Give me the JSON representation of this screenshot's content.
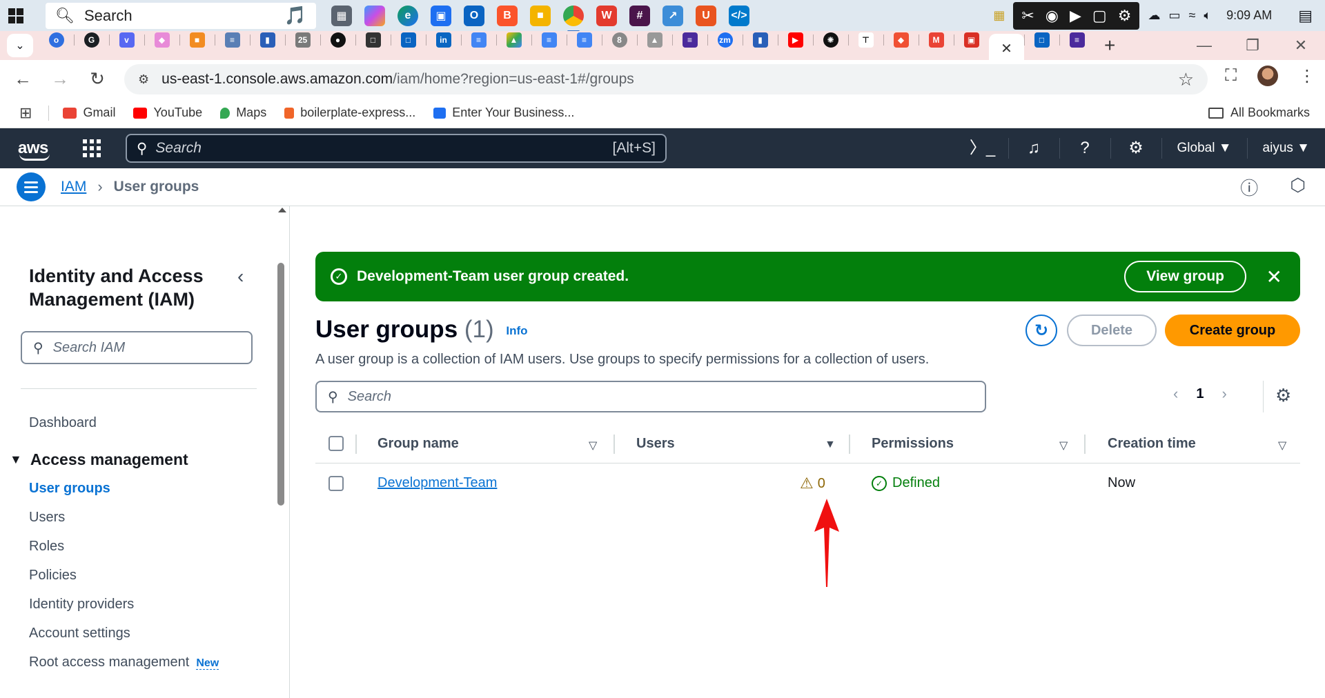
{
  "taskbar": {
    "search_placeholder": "Search",
    "time": "9:09 AM"
  },
  "browser": {
    "url_host": "us-east-1.console.aws.amazon.com",
    "url_path": "/iam/home?region=us-east-1#/groups",
    "bookmarks": [
      {
        "label": "Gmail",
        "color": "#ea4335"
      },
      {
        "label": "YouTube",
        "color": "#ff0000"
      },
      {
        "label": "Maps",
        "color": "#34a853"
      },
      {
        "label": "boilerplate-express...",
        "color": "#f06529"
      },
      {
        "label": "Enter Your Business...",
        "color": "#1e6ff1"
      }
    ],
    "all_bookmarks": "All Bookmarks"
  },
  "aws_nav": {
    "logo": "aws",
    "search_placeholder": "Search",
    "search_shortcut": "[Alt+S]",
    "region": "Global",
    "account": "aiyus"
  },
  "breadcrumb": {
    "root": "IAM",
    "current": "User groups"
  },
  "sidenav": {
    "title": "Identity and Access Management (IAM)",
    "search_placeholder": "Search IAM",
    "dashboard": "Dashboard",
    "section": "Access management",
    "items": [
      {
        "label": "User groups",
        "active": true
      },
      {
        "label": "Users"
      },
      {
        "label": "Roles"
      },
      {
        "label": "Policies"
      },
      {
        "label": "Identity providers"
      },
      {
        "label": "Account settings"
      },
      {
        "label": "Root access management",
        "badge": "New"
      }
    ]
  },
  "flash": {
    "message": "Development-Team user group created.",
    "view_button": "View group",
    "status_color": "#037f0c"
  },
  "page": {
    "title": "User groups",
    "count": "(1)",
    "info": "Info",
    "description": "A user group is a collection of IAM users. Use groups to specify permissions for a collection of users.",
    "delete_label": "Delete",
    "create_label": "Create group",
    "search_placeholder": "Search",
    "current_page": "1"
  },
  "table": {
    "columns": [
      "Group name",
      "Users",
      "Permissions",
      "Creation time"
    ],
    "rows": [
      {
        "group_name": "Development-Team",
        "users": "0",
        "permissions": "Defined",
        "creation_time": "Now"
      }
    ]
  }
}
